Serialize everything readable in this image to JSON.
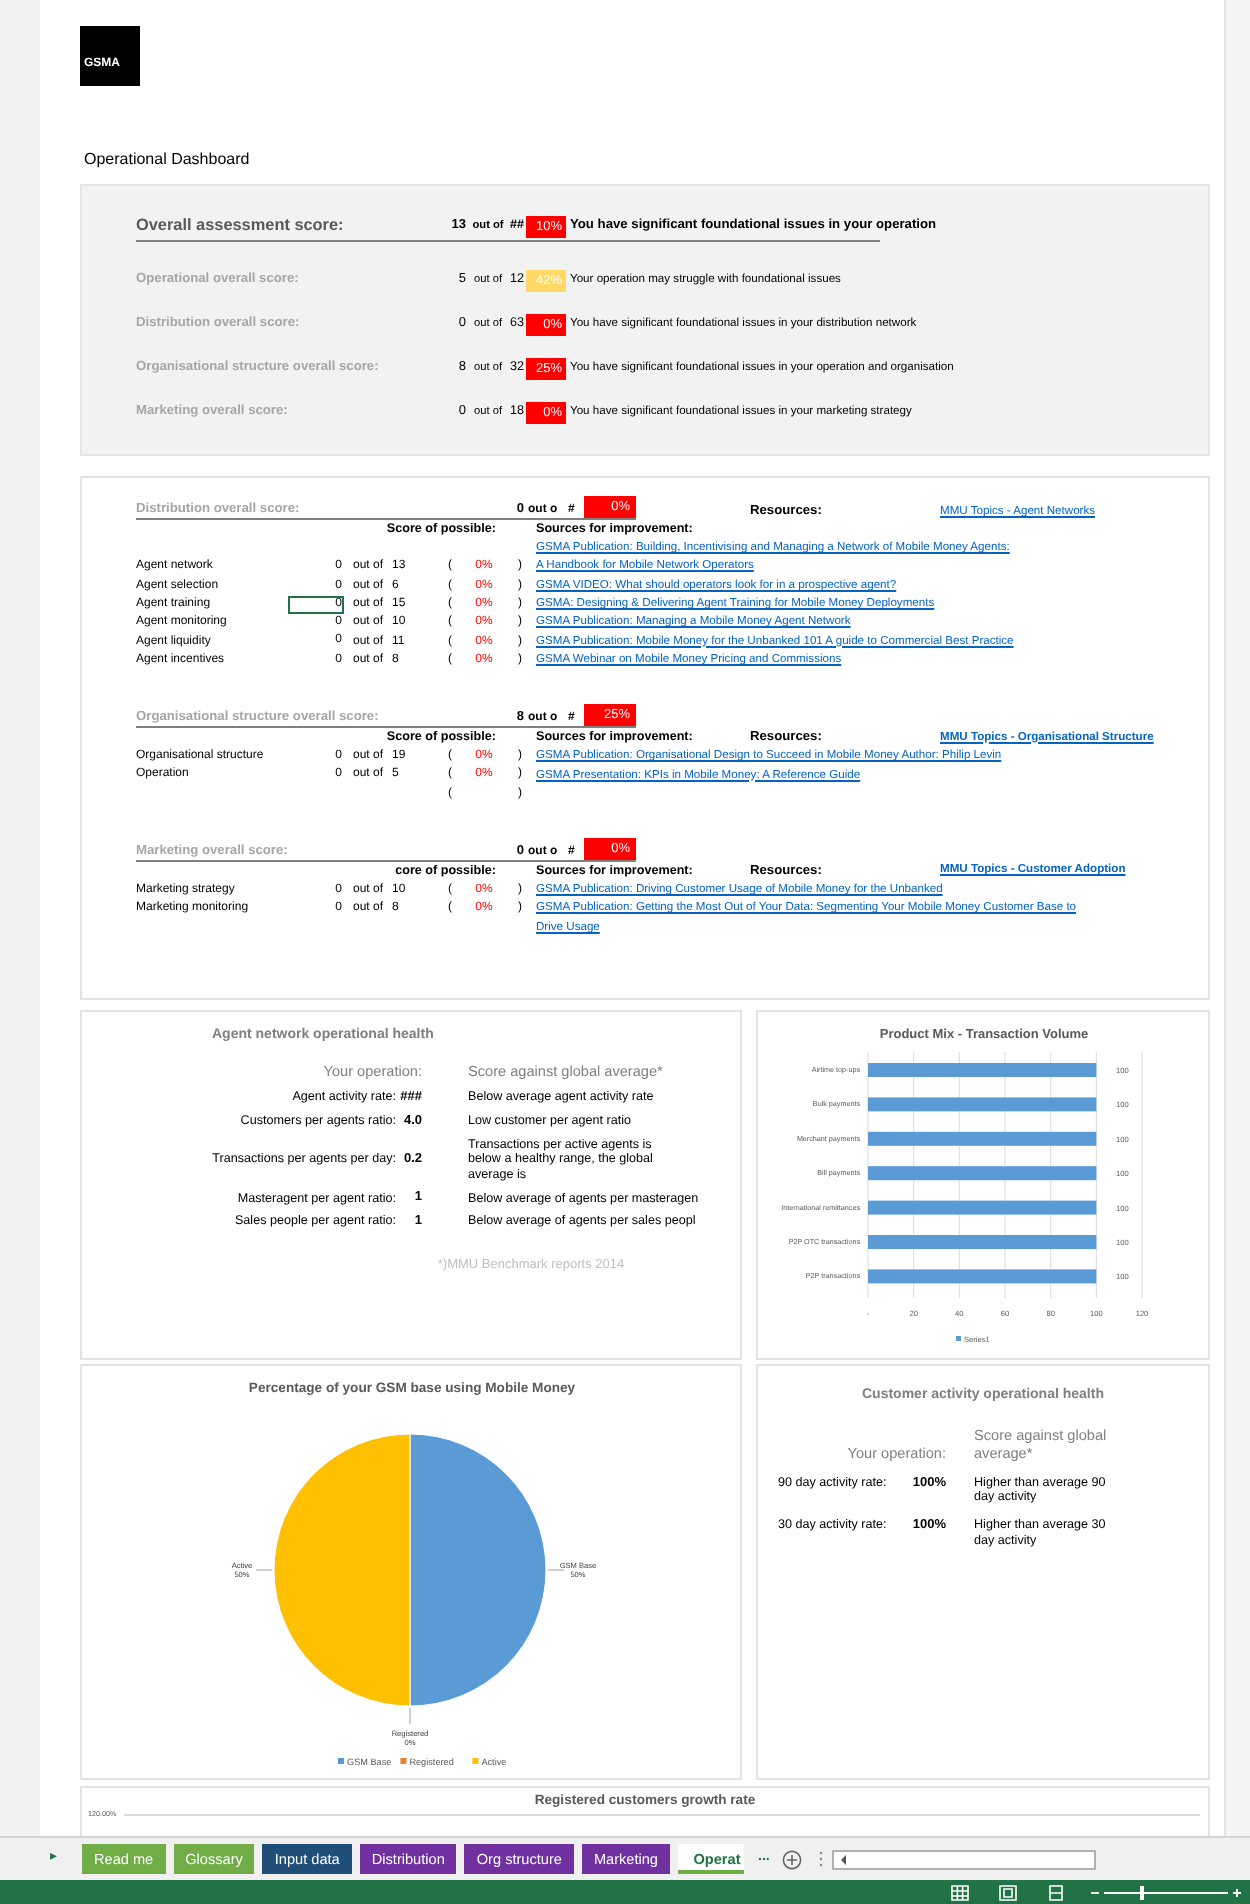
{
  "logo": "GSMA",
  "page_title": "Operational Dashboard",
  "overall": [
    {
      "kind": "main",
      "label": "Overall assessment score:",
      "score": "13",
      "out_of": "out of",
      "total": "##",
      "percent": "10%",
      "color": "#ff0000",
      "message": "You have significant foundational issues in your operation"
    },
    {
      "kind": "sub",
      "label": "Operational overall score:",
      "score": "5",
      "out_of": "out of",
      "total": "12",
      "percent": "42%",
      "color": "#ffd966",
      "message": "Your operation may struggle with foundational issues"
    },
    {
      "kind": "sub",
      "label": "Distribution overall score:",
      "score": "0",
      "out_of": "out of",
      "total": "63",
      "percent": "0%",
      "color": "#ff0000",
      "message": "You have significant foundational issues in your distribution network"
    },
    {
      "kind": "sub",
      "label": "Organisational structure overall score:",
      "score": "8",
      "out_of": "out of",
      "total": "32",
      "percent": "25%",
      "color": "#ff0000",
      "message": "You have significant foundational issues in your operation and organisation"
    },
    {
      "kind": "sub",
      "label": "Marketing overall score:",
      "score": "0",
      "out_of": "out of",
      "total": "18",
      "percent": "0%",
      "color": "#ff0000",
      "message": "You have significant foundational issues in your marketing strategy"
    }
  ],
  "sections": [
    {
      "header": {
        "label": "Distribution overall score:",
        "score": "0",
        "out_of": "out o",
        "total": "#",
        "percent": "0%",
        "color": "#ff0000",
        "resources": {
          "label": "Resources:",
          "link": "MMU Topics - Agent Networks"
        }
      },
      "subheader": {
        "score_heading": "Score of possible:",
        "sources_heading": "Sources for improvement:"
      },
      "rows": [
        {
          "kind": "link",
          "link": "GSMA Publication: Building, Incentivising and Managing a Network of Mobile Money Agents:"
        },
        {
          "kind": "item",
          "name": "Agent network",
          "score": "0",
          "out_of": "out of",
          "total": "13",
          "open": "(",
          "percent": "0%",
          "close": ")",
          "selected": false,
          "link": "A Handbook for Mobile Network Operators"
        },
        {
          "kind": "item",
          "name": "Agent selection",
          "score": "0",
          "out_of": "out of",
          "total": "6",
          "open": "(",
          "percent": "0%",
          "close": ")",
          "selected": false,
          "link": "GSMA VIDEO: What should operators look for in a prospective agent?"
        },
        {
          "kind": "item",
          "name": "Agent training",
          "score": "0",
          "out_of": "out of",
          "total": "15",
          "open": "(",
          "percent": "0%",
          "close": ")",
          "selected": true,
          "link": "GSMA: Designing & Delivering Agent Training for Mobile Money Deployments"
        },
        {
          "kind": "item",
          "name": "Agent monitoring",
          "score": "0",
          "out_of": "out of",
          "total": "10",
          "open": "(",
          "percent": "0%",
          "close": ")",
          "selected": false,
          "link": "GSMA Publication: Managing a Mobile Money Agent Network"
        },
        {
          "kind": "item",
          "name": "Agent liquidity",
          "score": "0",
          "out_of": "out of",
          "total": "11",
          "open": "(",
          "percent": "0%",
          "close": ")",
          "selected": false,
          "link": "GSMA Publication: Mobile Money for the Unbanked 101 A guide to Commercial Best Practice"
        },
        {
          "kind": "item",
          "name": "Agent incentives",
          "score": "0",
          "out_of": "out of",
          "total": "8",
          "open": "(",
          "percent": "0%",
          "close": ")",
          "selected": false,
          "link": "GSMA Webinar on Mobile Money Pricing and Commissions"
        }
      ]
    },
    {
      "header": {
        "label": "Organisational structure overall score:",
        "score": "8",
        "out_of": "out o",
        "total": "#",
        "percent": "25%",
        "color": "#ff0000"
      },
      "subheader": {
        "score_heading": "Score of possible:",
        "sources_heading": "Sources for improvement:",
        "resources": {
          "label": "Resources:",
          "link": "MMU Topics - Organisational Structure"
        }
      },
      "rows": [
        {
          "kind": "item",
          "name": "Organisational structure",
          "score": "0",
          "out_of": "out of",
          "total": "19",
          "open": "(",
          "percent": "0%",
          "close": ")",
          "selected": false,
          "link": "GSMA Publication: Organisational Design to Succeed in Mobile Money Author: Philip Levin"
        },
        {
          "kind": "item",
          "name": "Operation",
          "score": "0",
          "out_of": "out of",
          "total": "5",
          "open": "(",
          "percent": "0%",
          "close": ")",
          "selected": false,
          "link": "GSMA Presentation: KPIs in Mobile Money: A Reference Guide"
        },
        {
          "kind": "blank",
          "open": "(",
          "close": ")"
        }
      ]
    },
    {
      "header": {
        "label": "Marketing overall score:",
        "score": "0",
        "out_of": "out o",
        "total": "#",
        "percent": "0%",
        "color": "#ff0000"
      },
      "subheader": {
        "score_heading": "core of possible:",
        "sources_heading": "Sources for improvement:",
        "resources": {
          "label": "Resources:",
          "link": "MMU Topics - Customer Adoption"
        }
      },
      "rows": [
        {
          "kind": "item",
          "name": "Marketing strategy",
          "score": "0",
          "out_of": "out of",
          "total": "10",
          "open": "(",
          "percent": "0%",
          "close": ")",
          "selected": false,
          "link": "GSMA Publication: Driving Customer Usage of Mobile Money for the Unbanked"
        },
        {
          "kind": "item",
          "name": "Marketing monitoring",
          "score": "0",
          "out_of": "out of",
          "total": "8",
          "open": "(",
          "percent": "0%",
          "close": ")",
          "selected": false,
          "link": "GSMA Publication: Getting the Most Out of Your Data: Segmenting Your Mobile Money Customer Base to"
        },
        {
          "kind": "link",
          "link": "Drive Usage"
        }
      ]
    }
  ],
  "agent_health": {
    "title": "Agent network operational health",
    "your_heading": "Your operation:",
    "score_heading": "Score against global average*",
    "rows": [
      {
        "label": "Agent activity rate:",
        "value": "###",
        "comment": "Below average agent activity rate"
      },
      {
        "label": "Customers per agents ratio:",
        "value": "4.0",
        "comment": "Low customer per agent ratio"
      },
      {
        "label": "Transactions per agents per day:",
        "value": "0.2",
        "comment": "Transactions per active agents is below a healthy range, the global average is"
      },
      {
        "label": "Masteragent per agent ratio:",
        "value": "1",
        "comment": "Below average of agents per masteragen"
      },
      {
        "label": "Sales people per agent ratio:",
        "value": "1",
        "comment": "Below average of agents per sales peopl"
      }
    ],
    "footnote": "*)MMU Benchmark reports 2014"
  },
  "product_mix": {
    "chart_data": {
      "type": "bar",
      "orientation": "horizontal",
      "title": "Product Mix - Transaction Volume",
      "categories": [
        "Airtime top-ups",
        "Bulk payments",
        "Merchant payments",
        "Bill payments",
        "International remittances",
        "P2P OTC transactions",
        "P2P transactions"
      ],
      "series": [
        {
          "name": "Series1",
          "color": "#5b9bd5",
          "values": [
            100,
            100,
            100,
            100,
            100,
            100,
            100
          ]
        }
      ],
      "xlim": [
        0,
        120
      ],
      "xticks": [
        {
          "value": 0,
          "label": "-"
        },
        20,
        40,
        60,
        80,
        100,
        120
      ],
      "grid": true,
      "data_labels": true
    }
  },
  "gsm_base": {
    "chart_data": {
      "type": "pie",
      "title": "Percentage of your GSM base using Mobile Money",
      "categories": [
        "GSM Base",
        "Registered",
        "Active"
      ],
      "values": [
        50,
        0,
        50
      ],
      "colors": [
        "#5b9bd5",
        "#ed7d31",
        "#ffc000"
      ],
      "value_labels": [
        "50%",
        "0%",
        "50%"
      ]
    },
    "legend": [
      "GSM Base",
      "Registered",
      "Active"
    ]
  },
  "customer_health": {
    "title": "Customer activity operational health",
    "your_heading": "Your operation:",
    "score_heading": "Score against global average*",
    "rows": [
      {
        "label": "90 day activity rate:",
        "value": "100%",
        "comment": "Higher than average 90 day activity"
      },
      {
        "label": "30 day activity rate:",
        "value": "100%",
        "comment": "Higher than average 30 day activity"
      }
    ]
  },
  "growth": {
    "title": "Registered customers growth rate",
    "tick_label": "120.00%"
  },
  "sheet_tabs": {
    "nav": "▸",
    "more": "...",
    "tabs": [
      {
        "label": "Read me",
        "color": "#70ad47",
        "selected": false
      },
      {
        "label": "Glossary",
        "color": "#70ad47",
        "selected": false
      },
      {
        "label": "Input data",
        "color": "#1f4e79",
        "selected": false
      },
      {
        "label": "Distribution",
        "color": "#7030a0",
        "selected": false
      },
      {
        "label": "Org structure",
        "color": "#7030a0",
        "selected": false
      },
      {
        "label": "Marketing",
        "color": "#7030a0",
        "selected": false
      },
      {
        "label": "Operat",
        "color": "#70ad47",
        "selected": true
      }
    ]
  },
  "status_bar": {
    "zoom": {
      "level": 0.3
    }
  }
}
